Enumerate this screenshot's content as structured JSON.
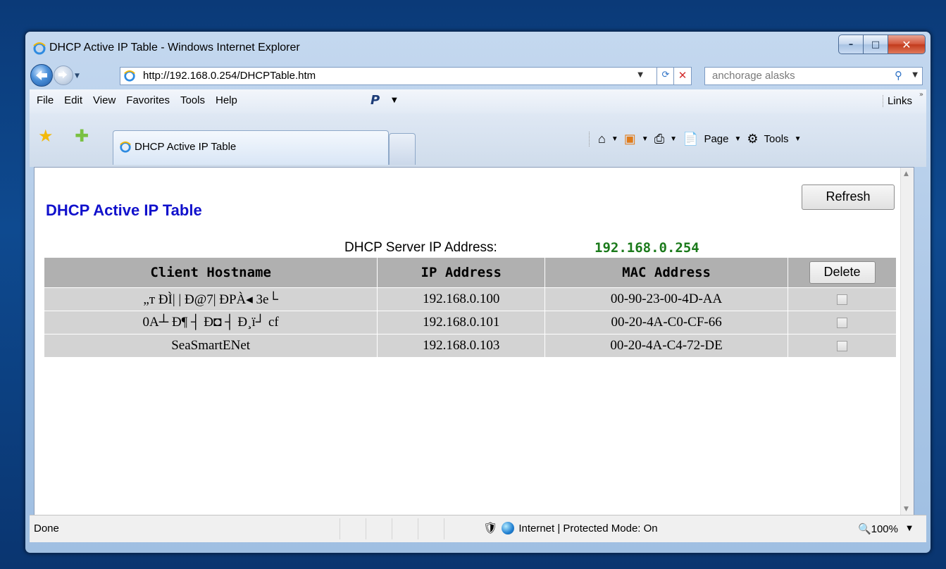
{
  "window": {
    "title": "DHCP Active IP Table - Windows Internet Explorer",
    "controls": {
      "minimize": "–",
      "maximize": "□",
      "close": "✕"
    }
  },
  "address_bar": {
    "url": "http://192.168.0.254/DHCPTable.htm",
    "search_placeholder": "anchorage alasks"
  },
  "menu": {
    "items": [
      "File",
      "Edit",
      "View",
      "Favorites",
      "Tools",
      "Help"
    ],
    "paypal_label": "P",
    "links_label": "Links"
  },
  "tabs": {
    "active_label": "DHCP Active IP Table"
  },
  "command_bar": {
    "page_label": "Page",
    "tools_label": "Tools"
  },
  "page": {
    "title": "DHCP Active IP Table",
    "refresh_button": "Refresh",
    "server_label": "DHCP Server IP Address:",
    "server_ip": "192.168.0.254",
    "table": {
      "headers": [
        "Client Hostname",
        "IP Address",
        "MAC Address"
      ],
      "delete_button": "Delete",
      "rows": [
        {
          "hostname": "„т ÐÌ| | Ð@7| ÐPÀ◂ 3e└",
          "ip": "192.168.0.100",
          "mac": "00-90-23-00-4D-AA"
        },
        {
          "hostname": "0A┴ Ð¶ ┤ Ð◘ ┤ Ð¸ï┘ cf",
          "ip": "192.168.0.101",
          "mac": "00-20-4A-C0-CF-66"
        },
        {
          "hostname": "SeaSmartENet",
          "ip": "192.168.0.103",
          "mac": "00-20-4A-C4-72-DE"
        }
      ]
    }
  },
  "status_bar": {
    "status": "Done",
    "zone": "Internet | Protected Mode: On",
    "zoom": "100%"
  },
  "colors": {
    "page_title": "#1111cc",
    "server_ip": "#1b7a1b",
    "table_header_bg": "#b0b0b0",
    "table_row_bg": "#d3d3d3"
  }
}
